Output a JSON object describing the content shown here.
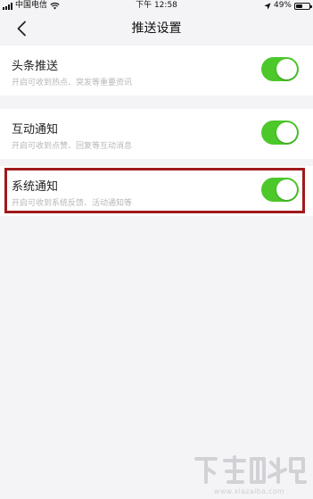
{
  "status_bar": {
    "carrier": "中国电信",
    "time": "下午 12:58",
    "battery_percent": "49%",
    "battery_level": 0.49
  },
  "nav": {
    "title": "推送设置"
  },
  "settings": [
    {
      "title": "头条推送",
      "description": "开启可收到热点、突发等重要资讯",
      "enabled": true
    },
    {
      "title": "互动通知",
      "description": "开启可收到点赞、回复等互动消息",
      "enabled": true
    },
    {
      "title": "系统通知",
      "description": "开启可收到系统反馈、活动通知等",
      "enabled": true
    }
  ],
  "colors": {
    "toggle_on": "#4cc82a",
    "highlight": "#a0191c",
    "background": "#f4f4f6"
  },
  "watermark": {
    "url": "www.xiazaiba.com"
  }
}
